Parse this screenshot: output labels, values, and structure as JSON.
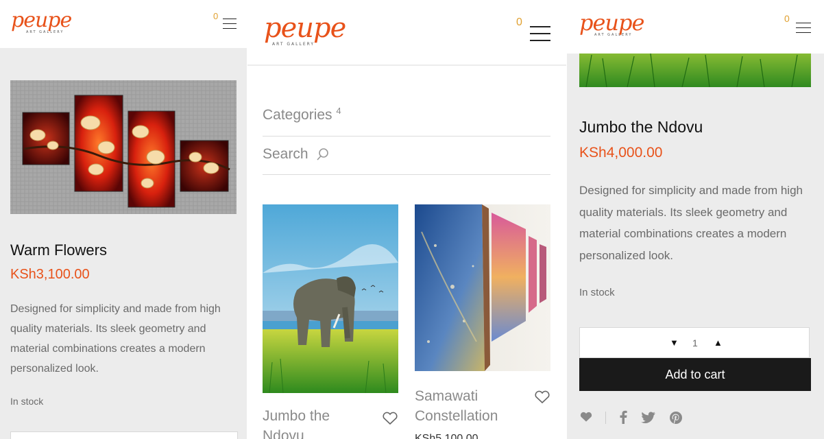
{
  "header": {
    "logo_text": "peupe",
    "logo_tagline": "ART GALLERY",
    "cart_count": "0"
  },
  "panel1": {
    "product_title": "Warm Flowers",
    "price": "KSh3,100.00",
    "description": "Designed for simplicity and made from high quality materials. Its sleek geometry and material combinations creates a modern personalized look.",
    "stock": "In stock"
  },
  "panel2": {
    "categories_label": "Categories",
    "categories_count": "4",
    "search_label": "Search",
    "products": [
      {
        "title_line1": "Jumbo the",
        "title_line2": "Ndovu"
      },
      {
        "title_line1": "Samawati",
        "title_line2": "Constellation",
        "price": "KSh5,100.00"
      }
    ]
  },
  "panel3": {
    "product_title": "Jumbo the Ndovu",
    "price": "KSh4,000.00",
    "description": "Designed for simplicity and made from high quality materials. Its sleek geometry and material combinations creates a modern personalized look.",
    "stock": "In stock",
    "quantity": "1",
    "add_to_cart_label": "Add to cart"
  },
  "colors": {
    "accent": "#e8521a",
    "cart_badge": "#e0a030",
    "button_bg": "#1a1a1a"
  }
}
